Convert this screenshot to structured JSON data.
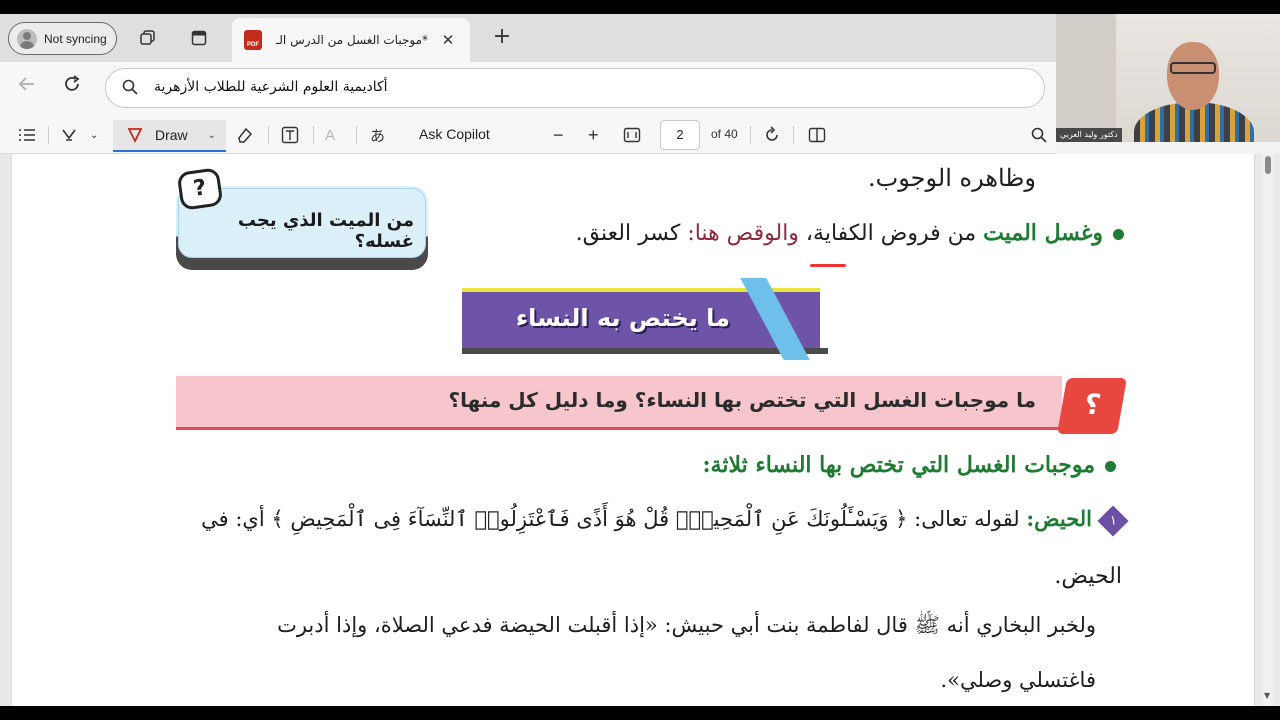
{
  "browser": {
    "profile_label": "Not syncing",
    "tab_title": "*موجبات الغسل من الدرس الـ",
    "tab_close": "✕",
    "new_tab": "+",
    "address": "أكاديمية العلوم الشرعية للطلاب الأزهرية"
  },
  "pdf_toolbar": {
    "draw_label": "Draw",
    "ask_copilot": "Ask Copilot",
    "zoom_out": "−",
    "zoom_in": "+",
    "page_current": "2",
    "page_total": "of 40",
    "read_aloud_glyph": "A",
    "translate_glyph": "あ"
  },
  "webcam": {
    "caption": "دكتور وليد العربي"
  },
  "document": {
    "line1": "وظاهره الوجوب.",
    "line2_green": "وغسل الميت",
    "line2_mid": " من فروض الكفاية، ",
    "line2_maroon": "والوقص هنا:",
    "line2_end": " كسر العنق.",
    "callout_question": "من الميت الذي يجب غسله؟",
    "callout_badge": "?",
    "banner_title": "ما يختص به النساء",
    "question_bar": "ما موجبات الغسل التي تختص بها النساء؟ وما دليل كل منها؟",
    "question_badge": "؟",
    "answer_heading": "موجبات الغسل التي تختص بها النساء ثلاثة:",
    "item1_number": "١",
    "item1_label": "الحيض:",
    "item1_text": " لقوله تعالى: ﴿ وَيَسْـَٔلُونَكَ عَنِ ٱلْمَحِيضِۖ قُلْ هُوَ أَذًى فَٱعْتَزِلُوا۟ ٱلنِّسَآءَ فِى ٱلْمَحِيضِ ﴾ أي: في",
    "item1_cont": "الحيض.",
    "hadith_line1": "ولخبر البخاري أنه ﷺ قال لفاطمة بنت أبي حبيش: «إذا أقبلت الحيضة فدعي الصلاة، وإذا أدبرت",
    "hadith_line2": "فاغتسلي وصلي»."
  }
}
